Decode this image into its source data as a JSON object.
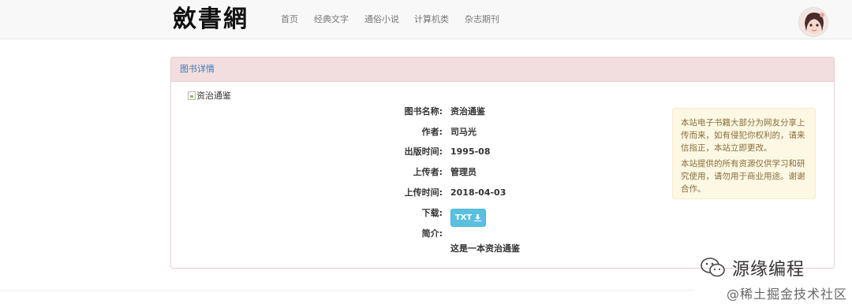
{
  "navbar": {
    "brand": "斂書網",
    "items": [
      "首页",
      "经典文字",
      "通俗小说",
      "计算机类",
      "杂志期刊"
    ]
  },
  "panel": {
    "heading": "图书详情",
    "cover_alt": "资治通鉴",
    "fields": {
      "title_label": "图书名称:",
      "title_value": "资治通鉴",
      "author_label": "作者:",
      "author_value": "司马光",
      "published_label": "出版时间:",
      "published_value": "1995-08",
      "uploader_label": "上传者:",
      "uploader_value": "管理员",
      "upload_time_label": "上传时间:",
      "upload_time_value": "2018-04-03",
      "download_label": "下载:",
      "download_button": "TXT",
      "intro_label": "简介:",
      "intro_value": "这是一本资治通鉴"
    },
    "notice": {
      "p1": "本站电子书籍大部分为网友分享上传而来，如有侵犯你权利的，请来信指正，本站立即更改。",
      "p2": "本站提供的所有资源仅供学习和研究使用，请勿用于商业用途。谢谢合作。"
    }
  },
  "watermark": {
    "channel": "源缘编程",
    "site": "@稀土掘金技术社区"
  },
  "colors": {
    "panel_heading_bg": "#f2dede",
    "heading_text": "#3a79b8",
    "button_info": "#5bc0de",
    "notice_bg": "#fcf8e3",
    "notice_text": "#8a6d3b"
  }
}
